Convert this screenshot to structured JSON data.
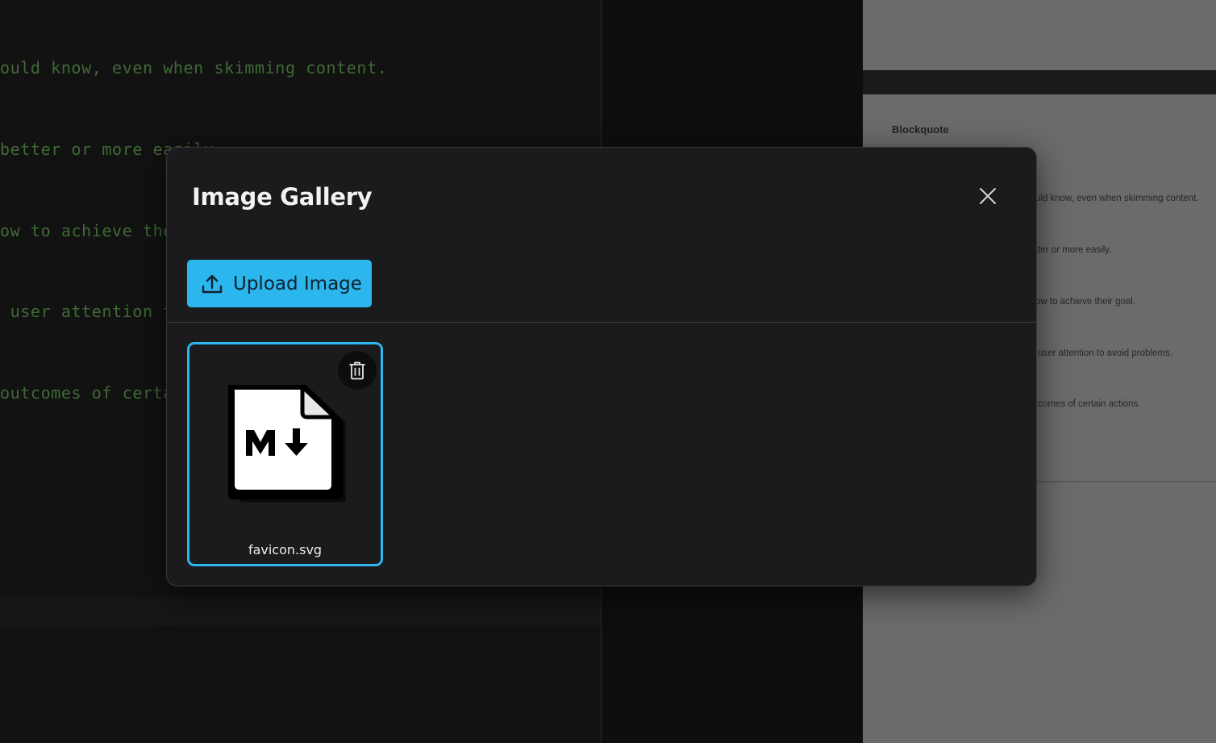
{
  "editor": {
    "lines": [
      "ould know, even when skimming content.",
      "better or more easily.",
      "ow to achieve their goal.",
      " user attention to avoid problems.",
      "outcomes of certain actions."
    ]
  },
  "preview": {
    "heading": "Blockquote",
    "lines": [
      "uld know, even when skimming content.",
      "tter or more easily.",
      "ow to achieve their goal.",
      "user attention to avoid problems.",
      "tcomes of certain actions."
    ]
  },
  "modal": {
    "title": "Image Gallery",
    "close_icon": "close-icon",
    "upload_label": "Upload Image",
    "upload_icon": "upload-icon",
    "images": [
      {
        "file_name": "favicon.svg",
        "thumb_icon": "markdown-file-icon",
        "delete_icon": "trash-icon",
        "selected": true
      }
    ]
  },
  "colors": {
    "accent": "#2bb6ee",
    "modal_bg": "#1b1b1d",
    "editor_text": "#3f6a36"
  }
}
